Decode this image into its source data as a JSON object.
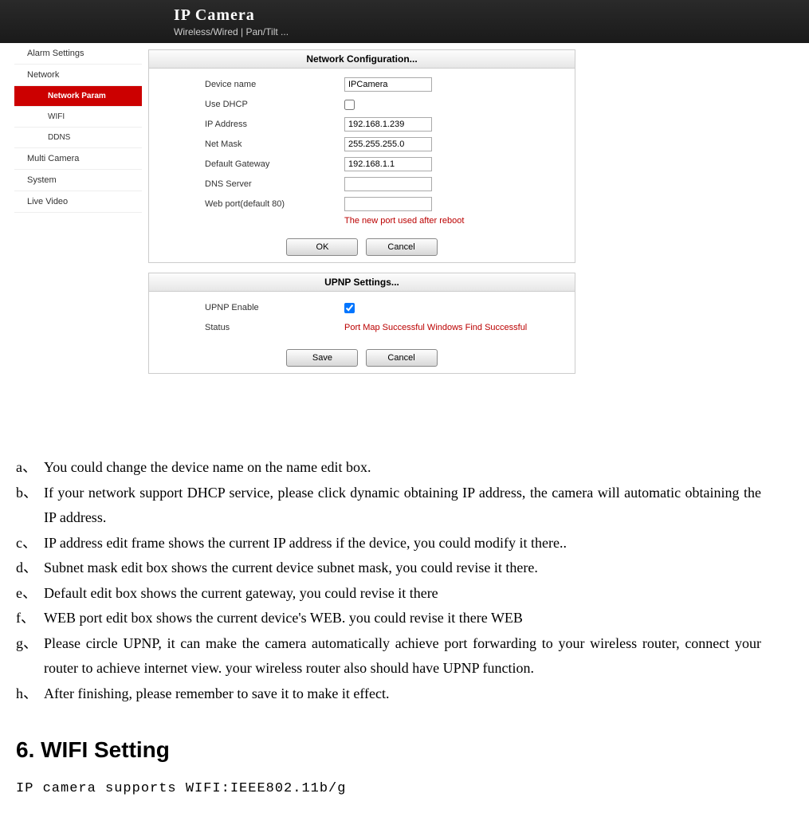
{
  "header": {
    "title": "IP Camera",
    "subtitle": "Wireless/Wired  |  Pan/Tilt  ..."
  },
  "sidebar": {
    "items": [
      {
        "label": "Alarm Settings",
        "sub": false,
        "active": false
      },
      {
        "label": "Network",
        "sub": false,
        "active": false
      },
      {
        "label": "Network Param",
        "sub": true,
        "active": true
      },
      {
        "label": "WIFI",
        "sub": true,
        "active": false
      },
      {
        "label": "DDNS",
        "sub": true,
        "active": false
      },
      {
        "label": "Multi Camera",
        "sub": false,
        "active": false
      },
      {
        "label": "System",
        "sub": false,
        "active": false
      },
      {
        "label": "Live Video",
        "sub": false,
        "active": false
      }
    ]
  },
  "network_config": {
    "title": "Network Configuration...",
    "device_name_label": "Device name",
    "device_name_value": "IPCamera",
    "use_dhcp_label": "Use DHCP",
    "use_dhcp_checked": false,
    "ip_label": "IP Address",
    "ip_value": "192.168.1.239",
    "netmask_label": "Net Mask",
    "netmask_value": "255.255.255.0",
    "gateway_label": "Default Gateway",
    "gateway_value": "192.168.1.1",
    "dns_label": "DNS Server",
    "dns_value": "",
    "webport_label": "Web port(default 80)",
    "webport_value": "",
    "hint": "The new port used after reboot",
    "ok": "OK",
    "cancel": "Cancel"
  },
  "upnp": {
    "title": "UPNP Settings...",
    "enable_label": "UPNP Enable",
    "enable_checked": true,
    "status_label": "Status",
    "status_value": "Port Map Successful Windows Find Successful",
    "save": "Save",
    "cancel": "Cancel"
  },
  "doc": {
    "items": [
      {
        "m": "a、",
        "t": "You could change the device name on the name edit box."
      },
      {
        "m": "b、",
        "t": "If your network support DHCP service, please click dynamic obtaining IP address, the camera will automatic obtaining the IP address."
      },
      {
        "m": "c、",
        "t": "IP address edit frame shows the current IP address if the device, you could modify it there.."
      },
      {
        "m": "d、",
        "t": "Subnet mask edit box shows the current device subnet mask, you could revise it there."
      },
      {
        "m": "e、",
        "t": "Default edit box shows the current gateway, you could revise it there"
      },
      {
        "m": "f、",
        "t": "WEB port edit box shows the current device's WEB. you could revise it there WEB"
      },
      {
        "m": "g、",
        "t": "Please circle UPNP, it can make the camera automatically achieve port forwarding to your wireless router, connect your router to achieve internet view. your wireless router also should have UPNP function."
      },
      {
        "m": "h、",
        "t": "After finishing, please remember to save it to make it effect."
      }
    ],
    "heading": "6. WIFI Setting",
    "wifi_line": "IP camera supports WIFI:IEEE802.11b/g"
  }
}
